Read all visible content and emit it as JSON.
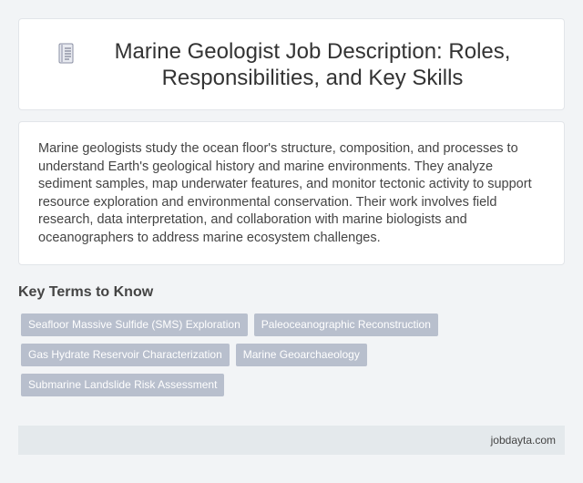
{
  "header": {
    "icon": "document-icon",
    "title": "Marine Geologist Job Description: Roles, Responsibilities, and Key Skills"
  },
  "description": {
    "text": "Marine geologists study the ocean floor's structure, composition, and processes to understand Earth's geological history and marine environments. They analyze sediment samples, map underwater features, and monitor tectonic activity to support resource exploration and environmental conservation. Their work involves field research, data interpretation, and collaboration with marine biologists and oceanographers to address marine ecosystem challenges."
  },
  "key_terms": {
    "heading": "Key Terms to Know",
    "tags": [
      "Seafloor Massive Sulfide (SMS) Exploration",
      "Paleoceanographic Reconstruction",
      "Gas Hydrate Reservoir Characterization",
      "Marine Geoarchaeology",
      "Submarine Landslide Risk Assessment"
    ]
  },
  "footer": {
    "site": "jobdayta.com"
  },
  "colors": {
    "background": "#f2f4f6",
    "tag_background": "#b8bfcd",
    "footer_background": "#e4e9ec"
  }
}
